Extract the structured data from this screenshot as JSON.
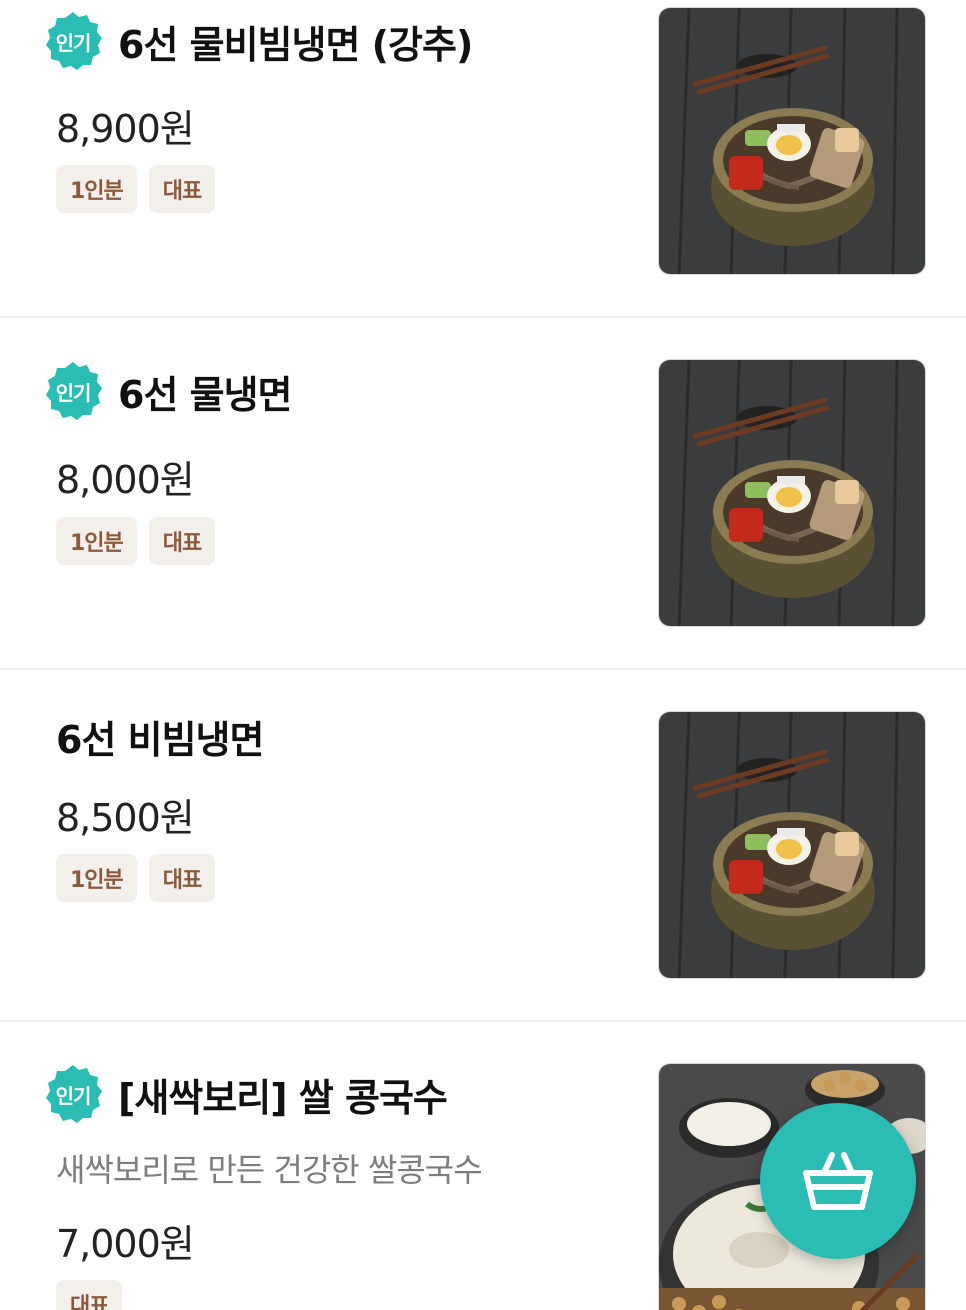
{
  "menu": {
    "items": [
      {
        "badge": "인기",
        "name": "6선 물비빔냉면 (강추)",
        "price": "8,900원",
        "tags": [
          "1인분",
          "대표"
        ],
        "image_icon": "bibim-naengmyeon-bowl-photo"
      },
      {
        "badge": "인기",
        "name": "6선 물냉면",
        "price": "8,000원",
        "tags": [
          "1인분",
          "대표"
        ],
        "image_icon": "mul-naengmyeon-bowl-photo"
      },
      {
        "name": "6선 비빔냉면",
        "price": "8,500원",
        "tags": [
          "1인분",
          "대표"
        ],
        "image_icon": "bibim-naengmyeon-bowl-photo"
      },
      {
        "badge": "인기",
        "name": "[새싹보리] 쌀 콩국수",
        "description": "새싹보리로 만든 건강한 쌀콩국수",
        "price": "7,000원",
        "tags": [
          "대표"
        ],
        "image_icon": "kongguksu-bowl-photo"
      }
    ]
  },
  "cart_button": {
    "icon": "basket-icon"
  },
  "colors": {
    "badge": "#2bbdb4",
    "tag_bg": "#f3efea",
    "tag_text": "#8b5a3c",
    "fab": "#2bbdb4",
    "description": "#7d7d7d"
  }
}
